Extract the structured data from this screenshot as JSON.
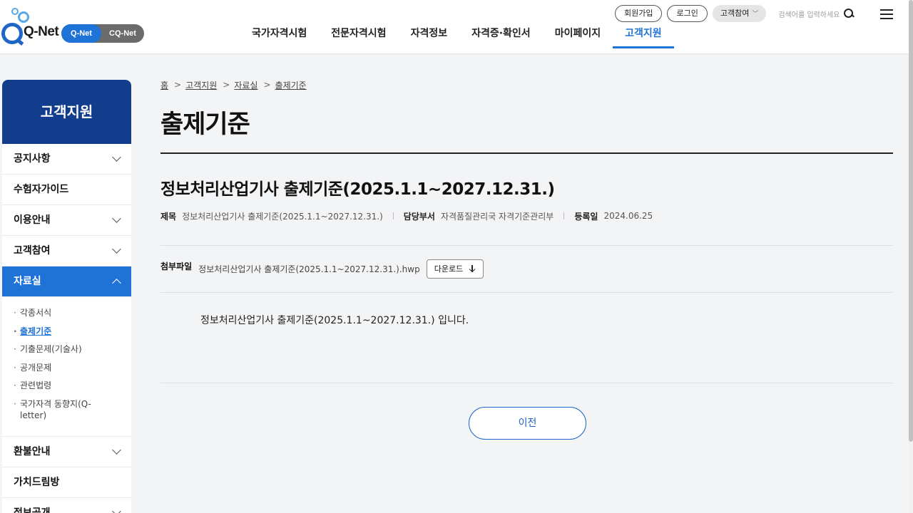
{
  "header": {
    "logo_text": "Q-Net",
    "net_toggle": {
      "active": "Q-Net",
      "other": "CQ-Net"
    },
    "gnb": [
      {
        "label": "국가자격시험",
        "active": false
      },
      {
        "label": "전문자격시험",
        "active": false
      },
      {
        "label": "자격정보",
        "active": false
      },
      {
        "label": "자격증·확인서",
        "active": false
      },
      {
        "label": "마이페이지",
        "active": false
      },
      {
        "label": "고객지원",
        "active": true
      }
    ],
    "util": {
      "signup": "회원가입",
      "login": "로그인",
      "customer": "고객참여",
      "search_placeholder": "검색어를 입력하세요"
    }
  },
  "sidebar": {
    "title": "고객지원",
    "items": [
      {
        "label": "공지사항",
        "chevron": "down"
      },
      {
        "label": "수험자가이드",
        "chevron": "none"
      },
      {
        "label": "이용안내",
        "chevron": "down"
      },
      {
        "label": "고객참여",
        "chevron": "down"
      },
      {
        "label": "자료실",
        "chevron": "up",
        "active": true
      },
      {
        "label": "환불안내",
        "chevron": "down"
      },
      {
        "label": "가치드림방",
        "chevron": "none"
      },
      {
        "label": "정보공개",
        "chevron": "down"
      }
    ],
    "sub_items": [
      {
        "label": "각종서식",
        "active": false
      },
      {
        "label": "출제기준",
        "active": true
      },
      {
        "label": "기출문제(기술사)",
        "active": false
      },
      {
        "label": "공개문제",
        "active": false
      },
      {
        "label": "관련법령",
        "active": false
      },
      {
        "label": "국가자격 동향지(Q-letter)",
        "active": false
      }
    ]
  },
  "breadcrumb": [
    "홈",
    "고객지원",
    "자료실",
    "출제기준"
  ],
  "page_title": "출제기준",
  "post": {
    "title": "정보처리산업기사 출제기준(2025.1.1~2027.12.31.)",
    "meta": {
      "subject_label": "제목",
      "subject_value": "정보처리산업기사 출제기준(2025.1.1~2027.12.31.)",
      "dept_label": "담당부서",
      "dept_value": "자격품질관리국 자격기준관리부",
      "date_label": "등록일",
      "date_value": "2024.06.25"
    },
    "attachment": {
      "label": "첨부파일",
      "filename": "정보처리산업기사 출제기준(2025.1.1~2027.12.31.).hwp",
      "download_label": "다운로드"
    },
    "body": "정보처리산업기사 출제기준(2025.1.1~2027.12.31.) 입니다."
  },
  "prev_button": "이전",
  "colors": {
    "accent": "#1f73d6",
    "sidebar_header": "#123d8c",
    "page_bg": "#f3f4f6"
  }
}
